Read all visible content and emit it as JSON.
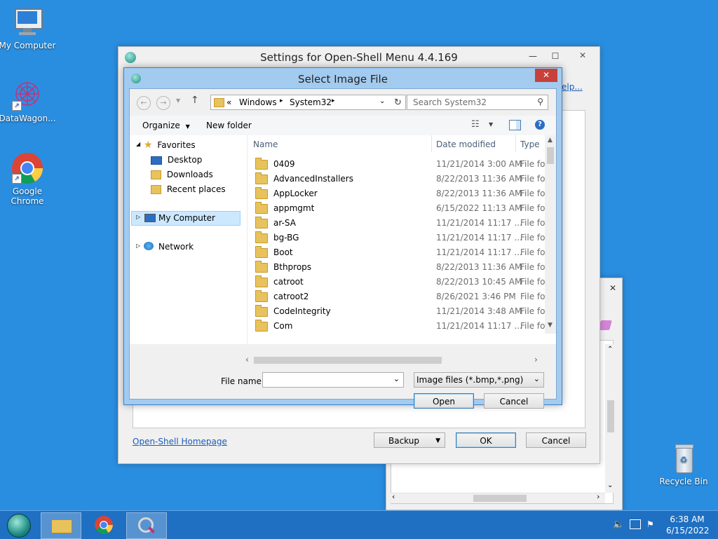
{
  "desktop": {
    "icons": [
      {
        "label": "My Computer"
      },
      {
        "label": "DataWagon..."
      },
      {
        "label": "Google\nChrome"
      },
      {
        "label": "Recycle Bin"
      }
    ]
  },
  "settings_window": {
    "title": "Settings for Open-Shell Menu 4.4.169",
    "help_link": "elp...",
    "homepage_link": "Open-Shell Homepage",
    "backup_label": "Backup",
    "ok_label": "OK",
    "cancel_label": "Cancel"
  },
  "dialog": {
    "title": "Select Image File",
    "breadcrumb": [
      "«",
      "Windows",
      "System32"
    ],
    "search_placeholder": "Search System32",
    "toolbar": {
      "organize": "Organize",
      "new_folder": "New folder"
    },
    "nav": {
      "favorites": "Favorites",
      "desktop": "Desktop",
      "downloads": "Downloads",
      "recent": "Recent places",
      "computer": "My Computer",
      "network": "Network"
    },
    "columns": {
      "name": "Name",
      "date": "Date modified",
      "type": "Type"
    },
    "files": [
      {
        "name": "0409",
        "date": "11/21/2014 3:00 AM",
        "type": "File fol"
      },
      {
        "name": "AdvancedInstallers",
        "date": "8/22/2013 11:36 AM",
        "type": "File fol"
      },
      {
        "name": "AppLocker",
        "date": "8/22/2013 11:36 AM",
        "type": "File fol"
      },
      {
        "name": "appmgmt",
        "date": "6/15/2022 11:13 AM",
        "type": "File fol"
      },
      {
        "name": "ar-SA",
        "date": "11/21/2014 11:17 ...",
        "type": "File fol"
      },
      {
        "name": "bg-BG",
        "date": "11/21/2014 11:17 ...",
        "type": "File fol"
      },
      {
        "name": "Boot",
        "date": "11/21/2014 11:17 ...",
        "type": "File fol"
      },
      {
        "name": "Bthprops",
        "date": "8/22/2013 11:36 AM",
        "type": "File fol"
      },
      {
        "name": "catroot",
        "date": "8/22/2013 10:45 AM",
        "type": "File fol"
      },
      {
        "name": "catroot2",
        "date": "8/26/2021 3:46 PM",
        "type": "File fol"
      },
      {
        "name": "CodeIntegrity",
        "date": "11/21/2014 3:48 AM",
        "type": "File fol"
      },
      {
        "name": "Com",
        "date": "11/21/2014 11:17 ...",
        "type": "File fol"
      }
    ],
    "file_name_label": "File name:",
    "file_name_value": "",
    "filter": "Image files (*.bmp,*.png)",
    "open_label": "Open",
    "cancel_label": "Cancel"
  },
  "taskbar": {
    "time": "6:38 AM",
    "date": "6/15/2022"
  }
}
